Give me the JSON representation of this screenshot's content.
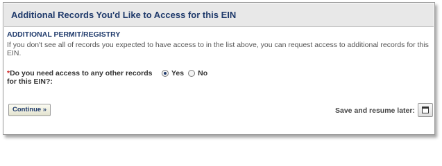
{
  "header": {
    "title": "Additional Records You'd Like to Access for this EIN"
  },
  "section": {
    "title": "ADDITIONAL PERMIT/REGISTRY",
    "description": "If you don't see all of records you expected to have access to in the list above, you can request access to additional records for this EIN."
  },
  "question": {
    "required_marker": "*",
    "label": "Do you need access to any other records for this EIN?:",
    "options": [
      {
        "label": "Yes",
        "selected": true
      },
      {
        "label": "No",
        "selected": false
      }
    ]
  },
  "actions": {
    "continue_label": "Continue »",
    "save_label": "Save and resume later:",
    "save_icon": "save-icon"
  }
}
